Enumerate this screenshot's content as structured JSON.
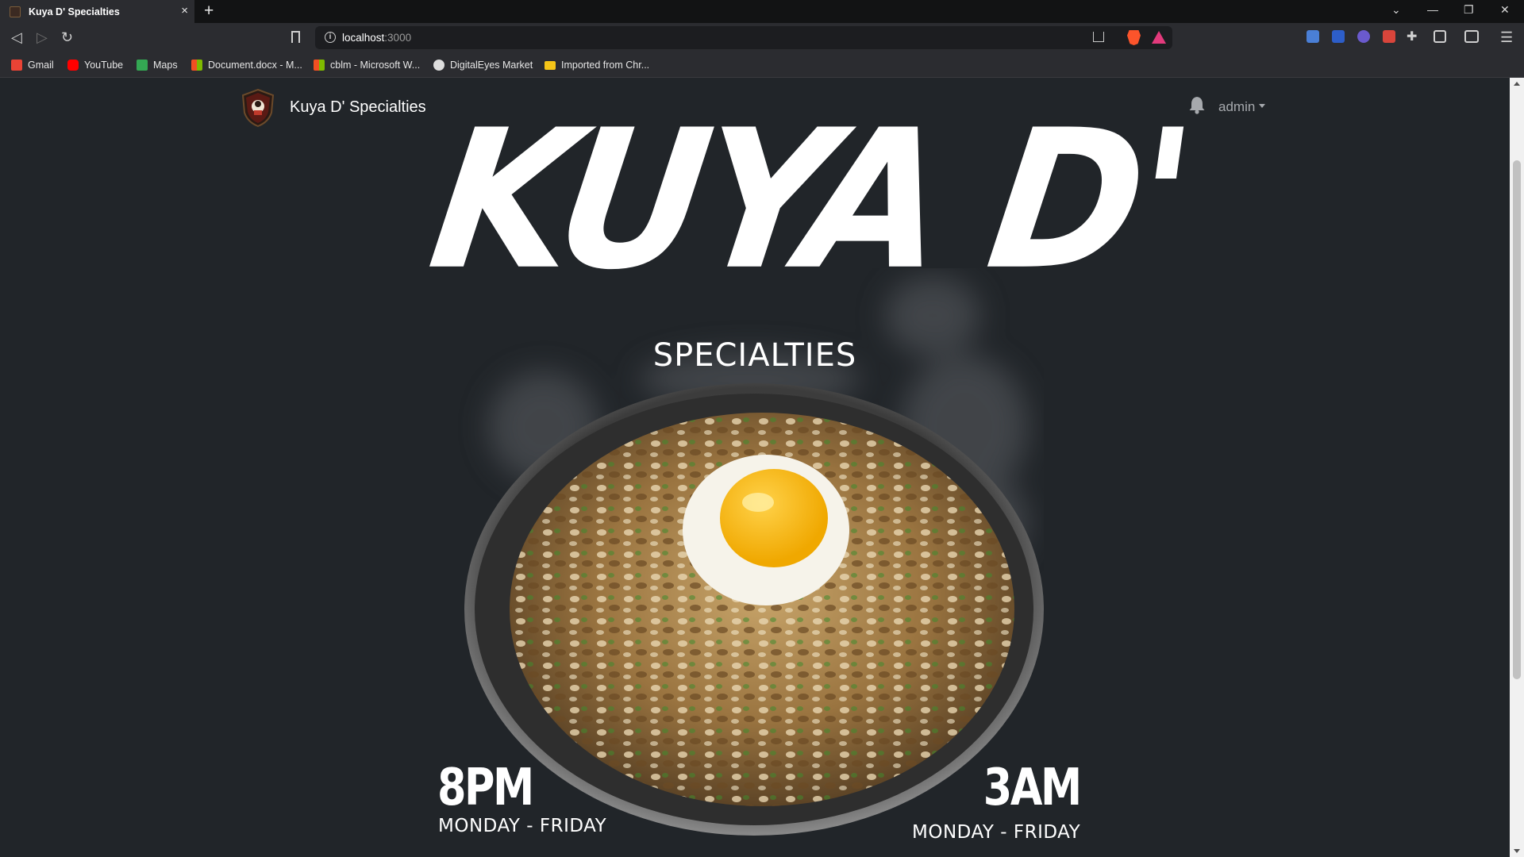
{
  "browser": {
    "tab_title": "Kuya D' Specialties",
    "tab_close": "×",
    "new_tab": "+",
    "url_host": "localhost",
    "url_port": ":3000",
    "bookmarks": [
      {
        "label": "Gmail",
        "icon": "gmail-icon",
        "color": "#ea4335"
      },
      {
        "label": "YouTube",
        "icon": "youtube-icon",
        "color": "#ff0000"
      },
      {
        "label": "Maps",
        "icon": "maps-icon",
        "color": "#34a853"
      },
      {
        "label": "Document.docx - M...",
        "icon": "microsoft-icon",
        "color": "#f25022"
      },
      {
        "label": "cblm - Microsoft W...",
        "icon": "microsoft-icon",
        "color": "#f25022"
      },
      {
        "label": "DigitalEyes Market",
        "icon": "digitaleyes-icon",
        "color": "#dddddd"
      },
      {
        "label": "Imported from Chr...",
        "icon": "folder-icon",
        "color": "#f5c518"
      }
    ]
  },
  "navbar": {
    "brand": "Kuya D' Specialties",
    "user": "admin"
  },
  "hero": {
    "title": "KUYA D'",
    "subtitle": "SPECIALTIES",
    "open_time": "8PM",
    "open_days": "MONDAY - FRIDAY",
    "close_time": "3AM",
    "close_days": "MONDAY - FRIDAY"
  },
  "colors": {
    "page_bg": "#212529",
    "accent_text": "#ffffff",
    "muted_text": "#a6a9ad"
  }
}
